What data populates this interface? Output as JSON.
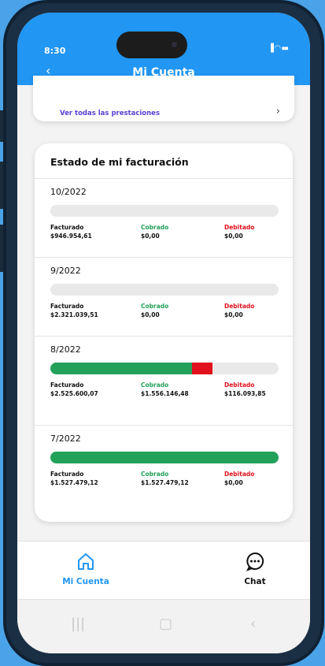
{
  "status_bar": {
    "time": "8:30",
    "icons": "▐◠▬"
  },
  "header": {
    "back_icon": "‹",
    "title": "Mi Cuenta"
  },
  "prestaciones": {
    "link_label": "Ver todas las prestaciones",
    "chevron": "›"
  },
  "facturacion": {
    "title": "Estado de mi facturación",
    "colors": {
      "cobrado": "#22a15a",
      "debitado": "#e0101c",
      "track": "#e9e9e9"
    },
    "periods": [
      {
        "period": "10/2022",
        "facturado_label": "Facturado",
        "facturado": "$946.954,61",
        "cobrado_label": "Cobrado",
        "cobrado": "$0,00",
        "debitado_label": "Debitado",
        "debitado": "$0,00",
        "cobrado_pct": 0,
        "debitado_pct": 0
      },
      {
        "period": "9/2022",
        "facturado_label": "Facturado",
        "facturado": "$2.321.039,51",
        "cobrado_label": "Cobrado",
        "cobrado": "$0,00",
        "debitado_label": "Debitado",
        "debitado": "$0,00",
        "cobrado_pct": 0,
        "debitado_pct": 0
      },
      {
        "period": "8/2022",
        "facturado_label": "Facturado",
        "facturado": "$2.525.600,07",
        "cobrado_label": "Cobrado",
        "cobrado": "$1.556.146,48",
        "debitado_label": "Debitado",
        "debitado": "$116.093,85",
        "cobrado_pct": 62,
        "debitado_pct": 9
      },
      {
        "period": "7/2022",
        "facturado_label": "Facturado",
        "facturado": "$1.527.479,12",
        "cobrado_label": "Cobrado",
        "cobrado": "$1.527.479,12",
        "debitado_label": "Debitado",
        "debitado": "$0,00",
        "cobrado_pct": 100,
        "debitado_pct": 0
      }
    ]
  },
  "bottom_nav": {
    "items": [
      {
        "label": "Mi Cuenta",
        "icon": "home-icon",
        "active": true,
        "color": "#2196f3"
      },
      {
        "label": "Chat",
        "icon": "chat-icon",
        "active": false,
        "color": "#111111"
      }
    ]
  },
  "system_nav": {
    "recents": "|||",
    "home": "▢",
    "back": "‹"
  }
}
